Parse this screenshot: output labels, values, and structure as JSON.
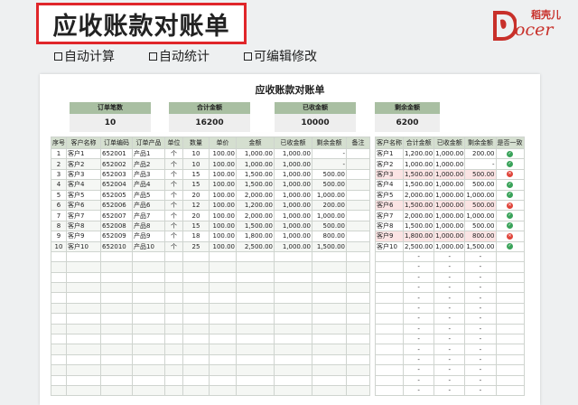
{
  "banner": {
    "title": "应收账款对账单"
  },
  "logo": {
    "cn": "稻壳儿",
    "en": "ocer"
  },
  "features": [
    "自动计算",
    "自动统计",
    "可编辑修改"
  ],
  "sheet": {
    "title": "应收账款对账单",
    "summary": [
      {
        "label": "订单笔数",
        "value": "10"
      },
      {
        "label": "合计金额",
        "value": "16200"
      },
      {
        "label": "已收金额",
        "value": "10000"
      },
      {
        "label": "剩余金额",
        "value": "6200"
      }
    ],
    "left_headers": [
      "序号",
      "客户名称",
      "订单编码",
      "订单产品",
      "单位",
      "数量",
      "单价",
      "金额",
      "已收金额",
      "剩余金额",
      "备注"
    ],
    "left_rows": [
      [
        "1",
        "客户1",
        "652001",
        "产品1",
        "个",
        "10",
        "100.00",
        "1,000.00",
        "1,000.00",
        "-",
        ""
      ],
      [
        "2",
        "客户2",
        "652002",
        "产品2",
        "个",
        "10",
        "100.00",
        "1,000.00",
        "1,000.00",
        "-",
        ""
      ],
      [
        "3",
        "客户3",
        "652003",
        "产品3",
        "个",
        "15",
        "100.00",
        "1,500.00",
        "1,000.00",
        "500.00",
        ""
      ],
      [
        "4",
        "客户4",
        "652004",
        "产品4",
        "个",
        "15",
        "100.00",
        "1,500.00",
        "1,000.00",
        "500.00",
        ""
      ],
      [
        "5",
        "客户5",
        "652005",
        "产品5",
        "个",
        "20",
        "100.00",
        "2,000.00",
        "1,000.00",
        "1,000.00",
        ""
      ],
      [
        "6",
        "客户6",
        "652006",
        "产品6",
        "个",
        "12",
        "100.00",
        "1,200.00",
        "1,000.00",
        "200.00",
        ""
      ],
      [
        "7",
        "客户7",
        "652007",
        "产品7",
        "个",
        "20",
        "100.00",
        "2,000.00",
        "1,000.00",
        "1,000.00",
        ""
      ],
      [
        "8",
        "客户8",
        "652008",
        "产品8",
        "个",
        "15",
        "100.00",
        "1,500.00",
        "1,000.00",
        "500.00",
        ""
      ],
      [
        "9",
        "客户9",
        "652009",
        "产品9",
        "个",
        "18",
        "100.00",
        "1,800.00",
        "1,000.00",
        "800.00",
        ""
      ],
      [
        "10",
        "客户10",
        "652010",
        "产品10",
        "个",
        "25",
        "100.00",
        "2,500.00",
        "1,000.00",
        "1,500.00",
        ""
      ]
    ],
    "right_headers": [
      "客户名称",
      "合计金额",
      "已收金额",
      "剩余金额",
      "是否一致"
    ],
    "right_rows": [
      [
        "客户1",
        "1,200.00",
        "1,000.00",
        "200.00",
        "ok"
      ],
      [
        "客户2",
        "1,000.00",
        "1,000.00",
        "-",
        "ok"
      ],
      [
        "客户3",
        "1,500.00",
        "1,000.00",
        "500.00",
        "bad"
      ],
      [
        "客户4",
        "1,500.00",
        "1,000.00",
        "500.00",
        "ok"
      ],
      [
        "客户5",
        "2,000.00",
        "1,000.00",
        "1,000.00",
        "ok"
      ],
      [
        "客户6",
        "1,500.00",
        "1,000.00",
        "500.00",
        "bad"
      ],
      [
        "客户7",
        "2,000.00",
        "1,000.00",
        "1,000.00",
        "ok"
      ],
      [
        "客户8",
        "1,500.00",
        "1,000.00",
        "500.00",
        "ok"
      ],
      [
        "客户9",
        "1,800.00",
        "1,000.00",
        "800.00",
        "bad"
      ],
      [
        "客户10",
        "2,500.00",
        "1,000.00",
        "1,500.00",
        "ok"
      ]
    ],
    "empty_dash": "-",
    "empty_rows": 14,
    "colors": {
      "header_green": "#a9bfa2",
      "ok": "#3aa35a",
      "bad": "#e0443a",
      "banner_border": "#e0262a"
    }
  }
}
